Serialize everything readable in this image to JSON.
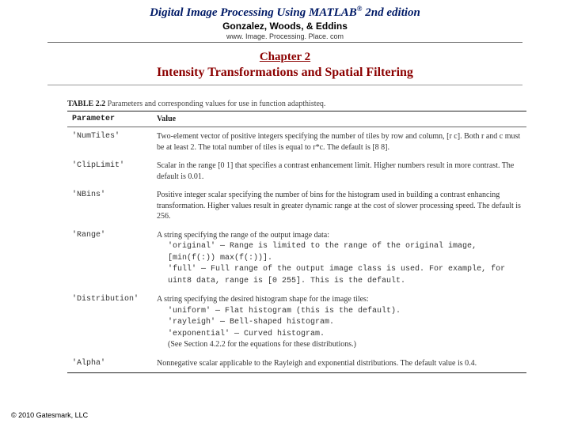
{
  "header": {
    "title_pre": "Digital Image Processing Using MATLAB",
    "title_sup": "®",
    "title_post": "  2nd edition",
    "authors": "Gonzalez, Woods, & Eddins",
    "site": "www. Image. Processing. Place. com"
  },
  "chapter": {
    "num": "Chapter 2",
    "title": "Intensity Transformations and Spatial Filtering"
  },
  "table": {
    "caption_label": "TABLE 2.2",
    "caption_text": " Parameters and corresponding values for use in function adapthisteq.",
    "head_param": "Parameter",
    "head_value": "Value",
    "rows": [
      {
        "param": "'NumTiles'",
        "value": "Two-element vector of positive integers specifying the number of tiles by row and column, [r c]. Both r and c must be at least 2. The total number of tiles is equal to r*c. The default is [8 8]."
      },
      {
        "param": "'ClipLimit'",
        "value": "Scalar in the range [0 1] that specifies a contrast enhancement limit. Higher numbers result in more contrast. The default is 0.01."
      },
      {
        "param": "'NBins'",
        "value": "Positive integer scalar specifying the number of bins for the histogram used in building a contrast enhancing transformation. Higher values result in greater dynamic range at the cost of slower processing speed. The default is 256."
      },
      {
        "param": "'Range'",
        "value_lines": [
          "A string specifying the range of the output image data:",
          "'original' — Range is limited to the range of the original image,",
          "[min(f(:)) max(f(:))].",
          "'full' — Full range of the output image class is used. For example, for uint8 data, range is [0 255]. This is the default."
        ]
      },
      {
        "param": "'Distribution'",
        "value_lines": [
          "A string specifying the desired histogram shape for the image tiles:",
          "'uniform' — Flat histogram (this is the default).",
          "'rayleigh' — Bell-shaped histogram.",
          "'exponential' — Curved histogram.",
          "(See Section 4.2.2 for the equations for these distributions.)"
        ]
      },
      {
        "param": "'Alpha'",
        "value": "Nonnegative scalar applicable to the Rayleigh and exponential distributions. The default value is 0.4."
      }
    ]
  },
  "copyright": "© 2010 Gatesmark, LLC"
}
